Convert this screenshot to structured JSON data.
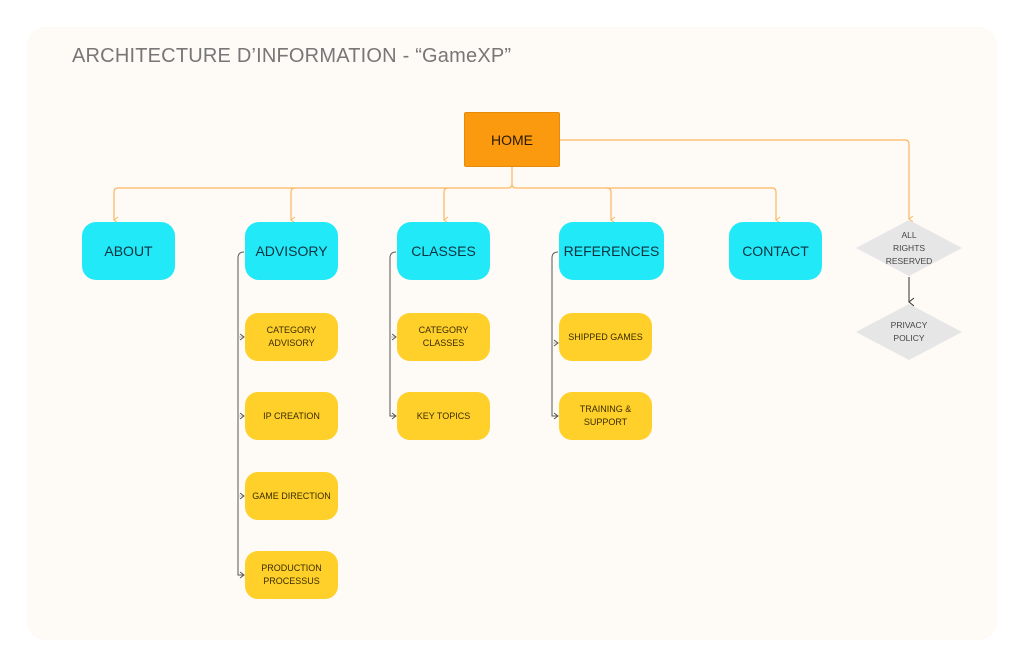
{
  "title": "ARCHITECTURE D’INFORMATION  - “GameXP”",
  "colors": {
    "home": "#fb9a0e",
    "level1": "#22e9f8",
    "level2": "#ffcf2a",
    "footer": "#e6e6e6",
    "main_links": "#fbb860",
    "sub_links": "#555555"
  },
  "home": {
    "label": "HOME"
  },
  "sections": [
    {
      "label": "ABOUT",
      "children": []
    },
    {
      "label": "ADVISORY",
      "children": [
        "CATEGORY ADVISORY",
        "IP CREATION",
        "GAME DIRECTION",
        "PRODUCTION PROCESSUS"
      ]
    },
    {
      "label": "CLASSES",
      "children": [
        "CATEGORY CLASSES",
        "KEY TOPICS"
      ]
    },
    {
      "label": "REFERENCES",
      "children": [
        "SHIPPED GAMES",
        "TRAINING & SUPPORT"
      ]
    },
    {
      "label": "CONTACT",
      "children": []
    }
  ],
  "footer": [
    "ALL RIGHTS RESERVED",
    "PRIVACY POLICY"
  ]
}
